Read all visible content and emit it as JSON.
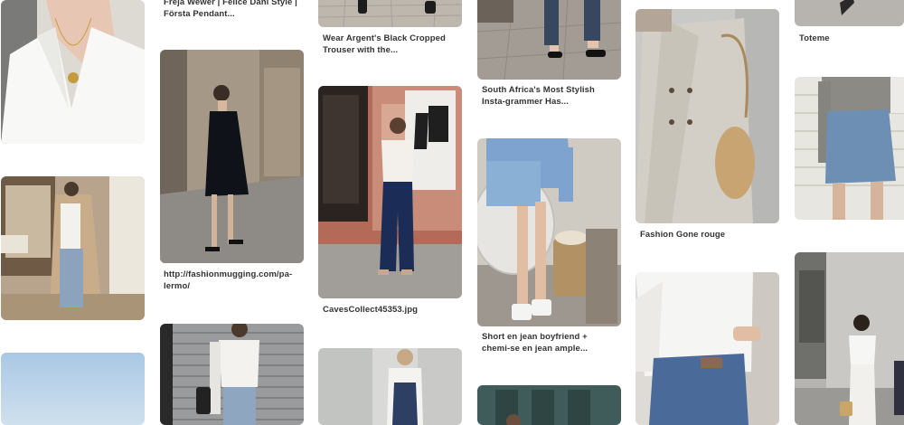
{
  "feed": {
    "captions": {
      "c2_top": "Freja Wewer | Felice Dahl Style | Första Pendant...",
      "c2_mid": "http://fashionmugging.com/pa-lermo/",
      "c3_top": "Wear Argent's Black Cropped Trouser with the...",
      "c3_mid": "CavesCollect45353.jpg",
      "c4_top": "South Africa's Most Stylish Insta-grammer Has...",
      "c4_mid": "Short en jean boyfriend + chemi-se en jean ample...",
      "c5_mid": "Fashion Gone rouge",
      "c6_top": "Toteme"
    },
    "pins": [
      {
        "name": "pin-white-shirt-necklace"
      },
      {
        "name": "pin-trench-coat-jeans"
      },
      {
        "name": "pin-sky"
      },
      {
        "name": "pin-black-slip-dress"
      },
      {
        "name": "pin-white-tee-shutter"
      },
      {
        "name": "pin-cobblestone-shoes"
      },
      {
        "name": "pin-missing-poster-outfit"
      },
      {
        "name": "pin-overalls"
      },
      {
        "name": "pin-loafers-street"
      },
      {
        "name": "pin-denim-shorts-bag"
      },
      {
        "name": "pin-teal-building"
      },
      {
        "name": "pin-beige-trench-basket"
      },
      {
        "name": "pin-white-shirt-jeans"
      },
      {
        "name": "pin-heels-top"
      },
      {
        "name": "pin-grey-shirt-denim-skirt"
      },
      {
        "name": "pin-white-tee-street"
      }
    ],
    "colors": {
      "background": "#ffffff",
      "caption": "#333333"
    }
  }
}
